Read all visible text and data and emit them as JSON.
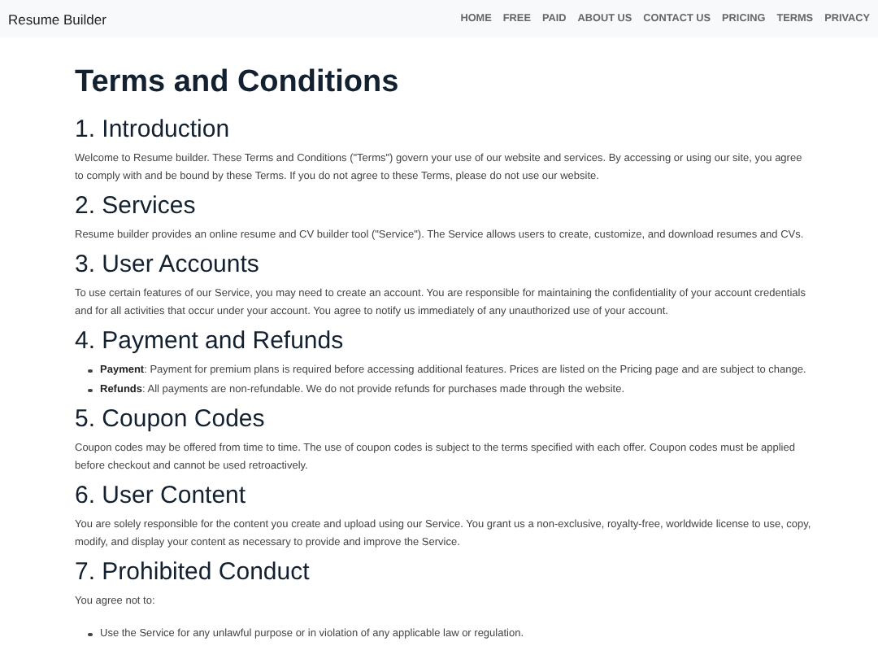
{
  "navbar": {
    "brand": "Resume Builder",
    "links": [
      "HOME",
      "FREE",
      "PAID",
      "ABOUT US",
      "CONTACT US",
      "PRICING",
      "TERMS",
      "PRIVACY"
    ]
  },
  "title": "Terms and Conditions",
  "sections": [
    {
      "heading": "1. Introduction",
      "paragraphs": [
        "Welcome to Resume builder. These Terms and Conditions (\"Terms\") govern your use of our website and services. By accessing or using our site, you agree to comply with and be bound by these Terms. If you do not agree to these Terms, please do not use our website."
      ]
    },
    {
      "heading": "2. Services",
      "paragraphs": [
        "Resume builder provides an online resume and CV builder tool (\"Service\"). The Service allows users to create, customize, and download resumes and CVs."
      ]
    },
    {
      "heading": "3. User Accounts",
      "paragraphs": [
        "To use certain features of our Service, you may need to create an account. You are responsible for maintaining the confidentiality of your account credentials and for all activities that occur under your account. You agree to notify us immediately of any unauthorized use of your account."
      ]
    },
    {
      "heading": "4. Payment and Refunds",
      "items": [
        "**Payment**: Payment for premium plans is required before accessing additional features. Prices are listed on the Pricing page and are subject to change.",
        "**Refunds**: All payments are non-refundable. We do not provide refunds for purchases made through the website."
      ]
    },
    {
      "heading": "5. Coupon Codes",
      "paragraphs": [
        "Coupon codes may be offered from time to time. The use of coupon codes is subject to the terms specified with each offer. Coupon codes must be applied before checkout and cannot be used retroactively."
      ]
    },
    {
      "heading": "6. User Content",
      "paragraphs": [
        "You are solely responsible for the content you create and upload using our Service. You grant us a non-exclusive, royalty-free, worldwide license to use, copy, modify, and display your content as necessary to provide and improve the Service."
      ]
    },
    {
      "heading": "7. Prohibited Conduct",
      "paragraphs": [
        "You agree not to:"
      ],
      "items": [
        "Use the Service for any unlawful purpose or in violation of any applicable law or regulation."
      ]
    }
  ]
}
